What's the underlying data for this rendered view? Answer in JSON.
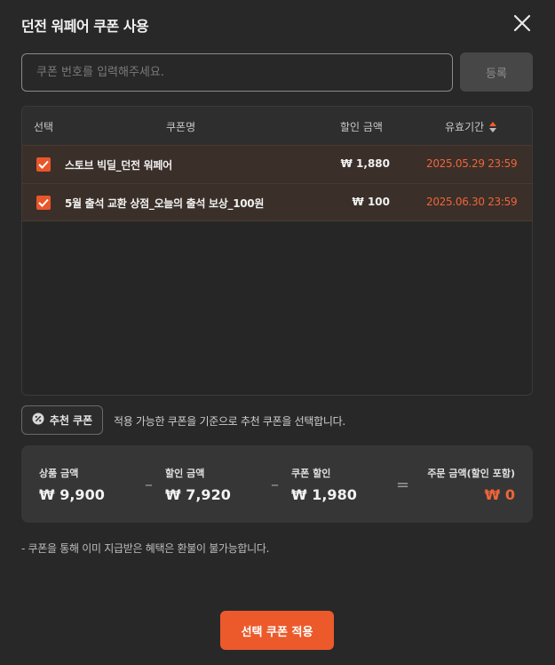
{
  "dialog": {
    "title": "던전 워페어 쿠폰 사용",
    "close_icon": "close-icon"
  },
  "coupon_entry": {
    "placeholder": "쿠폰 번호를 입력해주세요.",
    "value": "",
    "register_label": "등록"
  },
  "table": {
    "headers": {
      "select": "선택",
      "name": "쿠폰명",
      "discount": "할인 금액",
      "valid": "유효기간"
    },
    "sort_icon": "sort-updown-icon",
    "rows": [
      {
        "checked": true,
        "name": "스토브 빅딜_던전 워페어",
        "discount": "₩ 1,880",
        "valid_until": "2025.05.29 23:59"
      },
      {
        "checked": true,
        "name": "5월 출석 교환 상점_오늘의 출석 보상_100원",
        "discount": "₩ 100",
        "valid_until": "2025.06.30 23:59"
      }
    ]
  },
  "recommend": {
    "button_label": "추천 쿠폰",
    "icon": "discount-badge-icon",
    "description": "적용 가능한 쿠폰을 기준으로 추천 쿠폰을 선택합니다."
  },
  "summary": {
    "product_label": "상품 금액",
    "product_value": "₩ 9,900",
    "discount_label": "할인 금액",
    "discount_value": "₩ 7,920",
    "coupon_label": "쿠폰 할인",
    "coupon_value": "₩ 1,980",
    "total_label": "주문 금액(할인 포함)",
    "total_value": "₩ 0",
    "op_minus": "–",
    "op_equals": "="
  },
  "notice": "- 쿠폰을 통해 이미 지급받은 혜택은 환불이 불가능합니다.",
  "apply_label": "선택 쿠폰 적용",
  "colors": {
    "accent": "#ec5a2b",
    "date": "#f0643a",
    "background": "#282828",
    "row_selected": "#3a2f29"
  }
}
